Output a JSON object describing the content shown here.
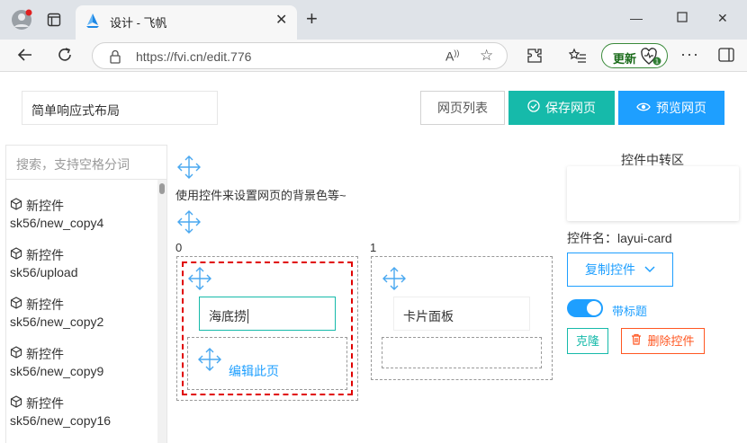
{
  "browser": {
    "tab_title": "设计 - 飞帆",
    "url": "https://fvi.cn/edit.776",
    "update_label": "更新"
  },
  "toolbar": {
    "page_name": "简单响应式布局",
    "list_label": "网页列表",
    "save_label": "保存网页",
    "preview_label": "预览网页"
  },
  "sidebar": {
    "search_placeholder": "搜索，支持空格分词",
    "items": [
      {
        "name": "新控件",
        "path": "sk56/new_copy4"
      },
      {
        "name": "新控件",
        "path": "sk56/upload"
      },
      {
        "name": "新控件",
        "path": "sk56/new_copy2"
      },
      {
        "name": "新控件",
        "path": "sk56/new_copy9"
      },
      {
        "name": "新控件",
        "path": "sk56/new_copy16"
      }
    ]
  },
  "canvas": {
    "hint": "使用控件来设置网页的背景色等~",
    "col0_index": "0",
    "col1_index": "1",
    "col0_input_value": "海底捞",
    "col0_edit_link": "编辑此页",
    "col1_card_label": "卡片面板"
  },
  "panel": {
    "transfer_title": "控件中转区",
    "control_name": "控件名：layui-card",
    "copy_label": "复制控件",
    "toggle_label": "带标题",
    "toggle_on": true,
    "clone_label": "克隆",
    "delete_label": "删除控件"
  },
  "colors": {
    "teal": "#16baaa",
    "blue": "#1e9fff",
    "red_selection": "#e00000",
    "delete_orange": "#ff5722"
  }
}
